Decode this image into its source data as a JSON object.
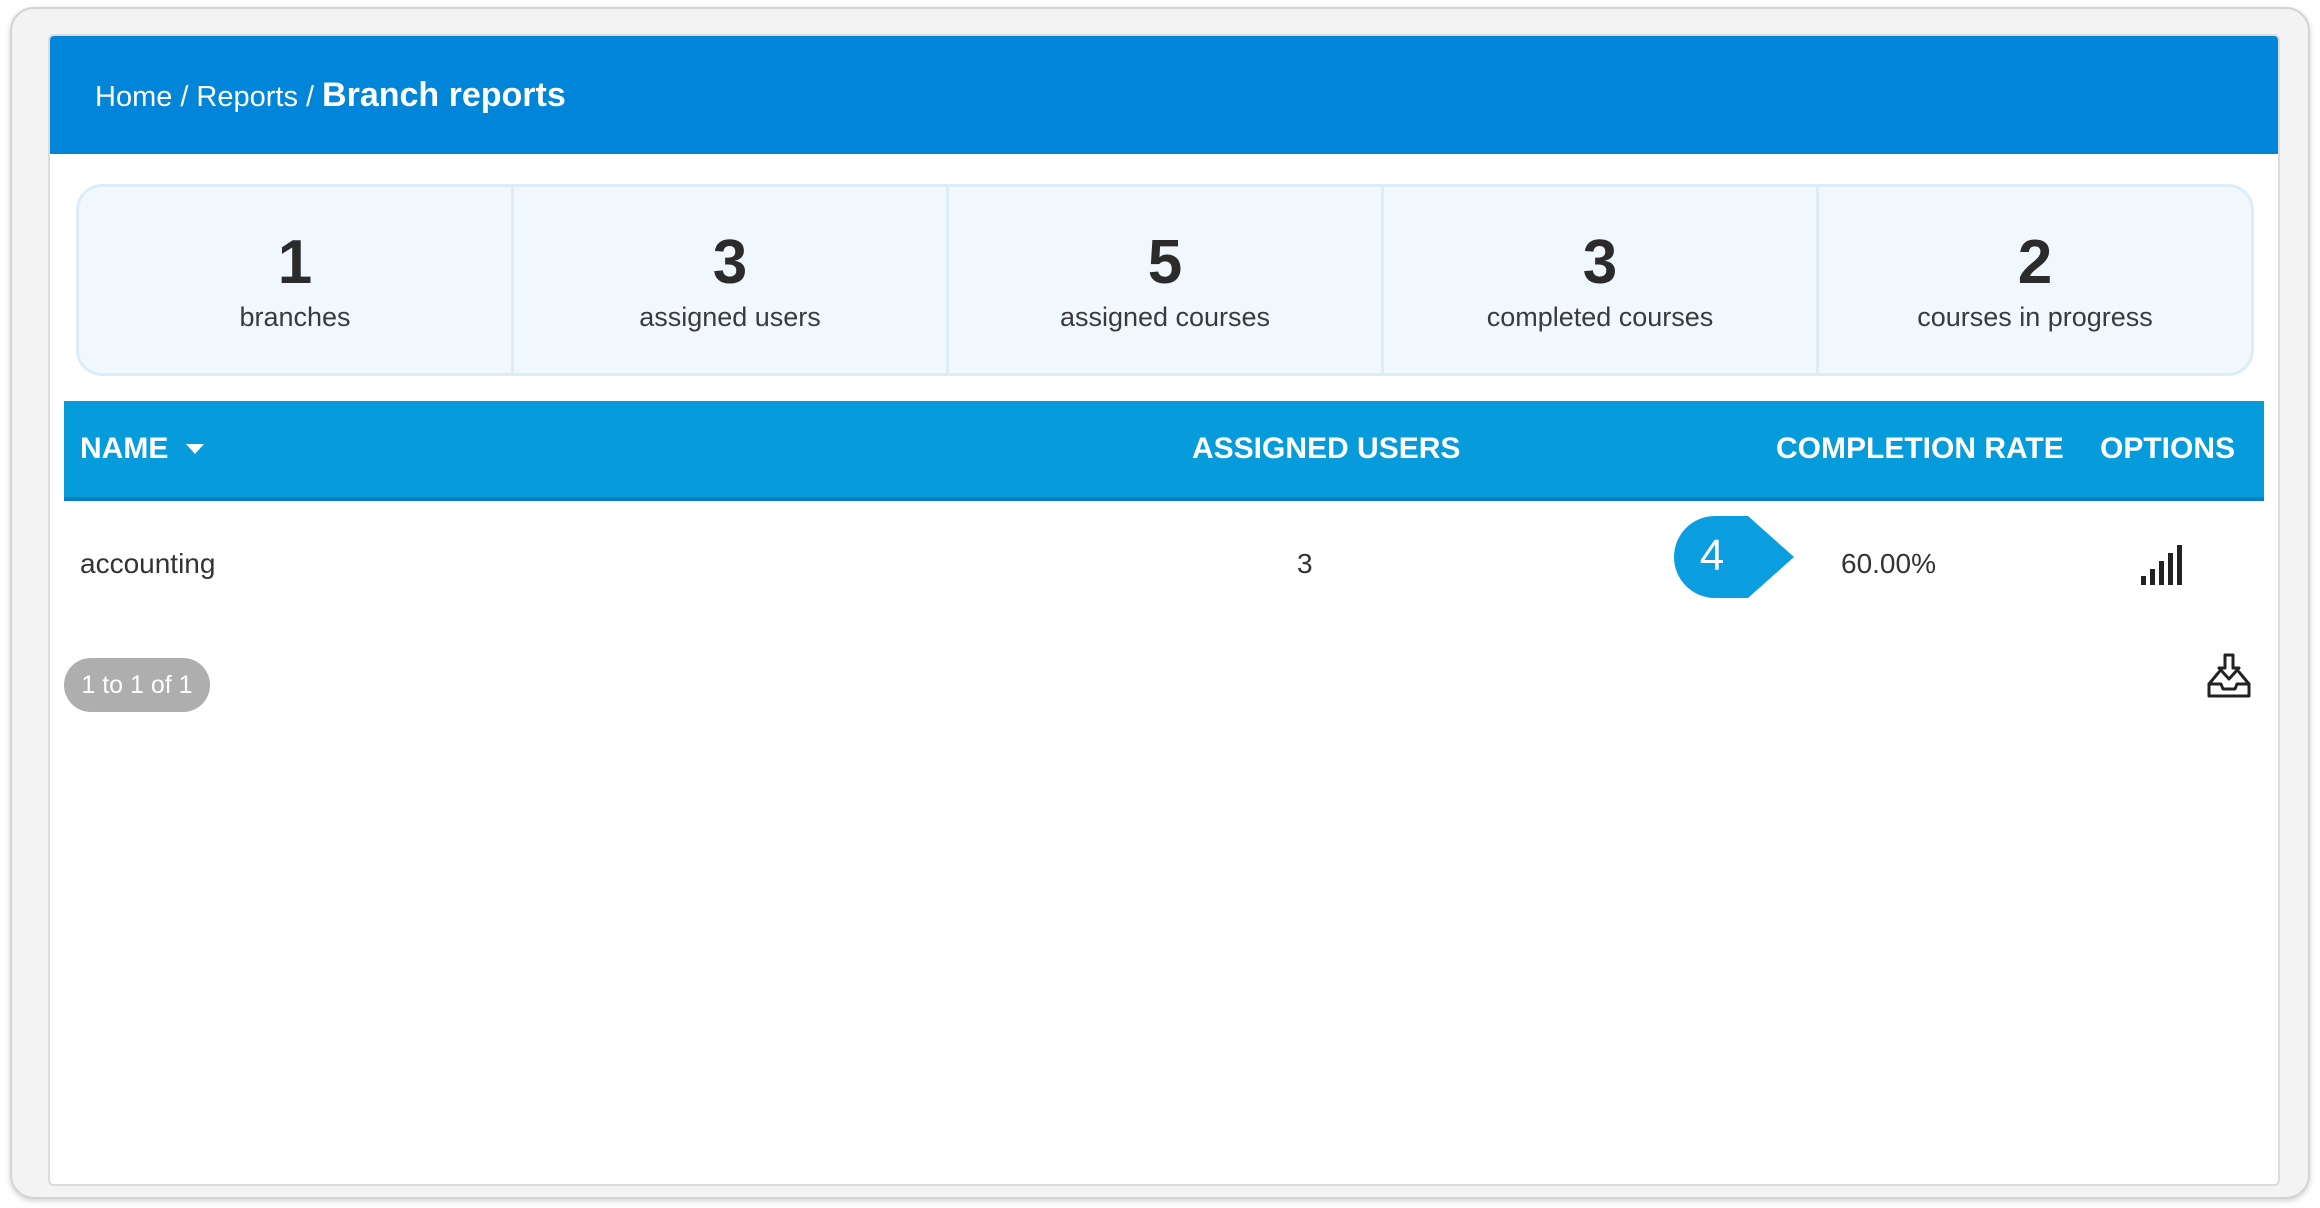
{
  "breadcrumb": {
    "items": [
      "Home",
      "Reports"
    ],
    "separator": "/",
    "current": "Branch reports"
  },
  "stats": [
    {
      "value": "1",
      "label": "branches"
    },
    {
      "value": "3",
      "label": "assigned users"
    },
    {
      "value": "5",
      "label": "assigned courses"
    },
    {
      "value": "3",
      "label": "completed courses"
    },
    {
      "value": "2",
      "label": "courses in progress"
    }
  ],
  "table": {
    "columns": {
      "name": "NAME",
      "assigned_users": "ASSIGNED USERS",
      "completion_rate": "COMPLETION RATE",
      "options": "OPTIONS"
    },
    "sort": {
      "column": "NAME",
      "direction": "descending-indicator"
    },
    "rows": [
      {
        "name": "accounting",
        "assigned_users": "3",
        "completion_rate": "60.00%",
        "options_icon": "bar-chart-icon"
      }
    ]
  },
  "callout": {
    "number": "4",
    "color": "#0a9ee0"
  },
  "pagination": {
    "label": "1 to 1 of 1"
  },
  "export_icon": "download-tray-icon",
  "colors": {
    "header": "#0085d9",
    "table_header": "#069cdb",
    "stats_bg": "#f0f8fe",
    "pager_bg": "#aeaeae"
  }
}
